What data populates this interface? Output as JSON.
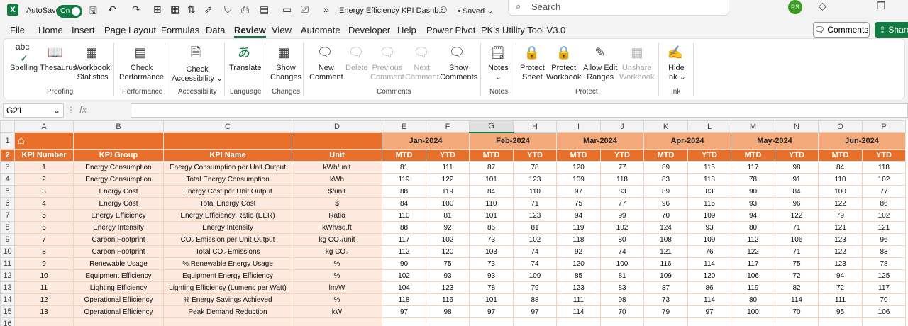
{
  "titlebar": {
    "app_icon": "X",
    "autosave_label": "AutoSave",
    "toggle_label": "On",
    "doc_title": "Energy Efficiency KPI Dashb...",
    "saved_label": "Saved",
    "search_placeholder": "Search",
    "avatar": "PS"
  },
  "menu": [
    "File",
    "Home",
    "Insert",
    "Page Layout",
    "Formulas",
    "Data",
    "Review",
    "View",
    "Automate",
    "Developer",
    "Help",
    "Power Pivot",
    "PK's Utility Tool V3.0"
  ],
  "active_menu": "Review",
  "comments_btn": "Comments",
  "share_btn": "Share",
  "ribbon": {
    "spelling_top": "abc",
    "spelling": "Spelling",
    "thesaurus": "Thesaurus",
    "wb_stats_1": "Workbook",
    "wb_stats_2": "Statistics",
    "check_perf_1": "Check",
    "check_perf_2": "Performance",
    "check_acc_1": "Check",
    "check_acc_2": "Accessibility",
    "translate": "Translate",
    "show_changes_1": "Show",
    "show_changes_2": "Changes",
    "new_comment_1": "New",
    "new_comment_2": "Comment",
    "delete": "Delete",
    "previous_1": "Previous",
    "previous_2": "Comment",
    "next_1": "Next",
    "next_2": "Comment",
    "show_comments_1": "Show",
    "show_comments_2": "Comments",
    "notes": "Notes",
    "protect_sheet_1": "Protect",
    "protect_sheet_2": "Sheet",
    "protect_wb_1": "Protect",
    "protect_wb_2": "Workbook",
    "allow_edit_1": "Allow Edit",
    "allow_edit_2": "Ranges",
    "unshare_1": "Unshare",
    "unshare_2": "Workbook",
    "hide_ink_1": "Hide",
    "hide_ink_2": "Ink",
    "groups": {
      "proofing": "Proofing",
      "performance": "Performance",
      "accessibility": "Accessibility",
      "language": "Language",
      "changes": "Changes",
      "comments": "Comments",
      "notes": "Notes",
      "protect": "Protect",
      "ink": "Ink"
    }
  },
  "formula_bar": {
    "name_box": "G21",
    "fx": "fx"
  },
  "columns": [
    "A",
    "B",
    "C",
    "D",
    "E",
    "F",
    "G",
    "H",
    "I",
    "J",
    "K",
    "L",
    "M",
    "N",
    "O",
    "P"
  ],
  "rows": [
    "1",
    "2",
    "3",
    "4",
    "5",
    "6",
    "7",
    "8",
    "9",
    "10",
    "11",
    "12",
    "13",
    "14",
    "15",
    "16"
  ],
  "header": {
    "kpi_number": "KPI Number",
    "kpi_group": "KPI Group",
    "kpi_name": "KPI Name",
    "unit": "Unit",
    "months": [
      "Jan-2024",
      "Feb-2024",
      "Mar-2024",
      "Apr-2024",
      "May-2024",
      "Jun-2024"
    ],
    "mtd": "MTD",
    "ytd": "YTD"
  },
  "table": [
    {
      "num": "1",
      "group": "Energy Consumption",
      "name": "Energy Consumption per Unit Output",
      "unit": "kWh/unit",
      "v": [
        "81",
        "111",
        "87",
        "78",
        "120",
        "77",
        "89",
        "116",
        "117",
        "98",
        "84",
        "118"
      ]
    },
    {
      "num": "2",
      "group": "Energy Consumption",
      "name": "Total Energy Consumption",
      "unit": "kWh",
      "v": [
        "119",
        "122",
        "101",
        "123",
        "109",
        "118",
        "83",
        "118",
        "78",
        "91",
        "110",
        "102"
      ]
    },
    {
      "num": "3",
      "group": "Energy Cost",
      "name": "Energy Cost per Unit Output",
      "unit": "$/unit",
      "v": [
        "88",
        "119",
        "84",
        "110",
        "97",
        "83",
        "89",
        "83",
        "90",
        "84",
        "100",
        "77"
      ]
    },
    {
      "num": "4",
      "group": "Energy Cost",
      "name": "Total Energy Cost",
      "unit": "$",
      "v": [
        "84",
        "100",
        "110",
        "71",
        "75",
        "77",
        "96",
        "115",
        "93",
        "96",
        "122",
        "86"
      ]
    },
    {
      "num": "5",
      "group": "Energy Efficiency",
      "name": "Energy Efficiency Ratio (EER)",
      "unit": "Ratio",
      "v": [
        "110",
        "81",
        "101",
        "123",
        "94",
        "99",
        "70",
        "109",
        "94",
        "122",
        "79",
        "102"
      ]
    },
    {
      "num": "6",
      "group": "Energy Intensity",
      "name": "Energy Intensity",
      "unit": "kWh/sq.ft",
      "v": [
        "88",
        "92",
        "86",
        "81",
        "119",
        "102",
        "124",
        "93",
        "80",
        "71",
        "121",
        "121"
      ]
    },
    {
      "num": "7",
      "group": "Carbon Footprint",
      "name": "CO₂ Emission per Unit Output",
      "unit": "kg CO₂/unit",
      "v": [
        "117",
        "102",
        "73",
        "102",
        "118",
        "80",
        "108",
        "109",
        "112",
        "106",
        "123",
        "96"
      ]
    },
    {
      "num": "8",
      "group": "Carbon Footprint",
      "name": "Total CO₂ Emissions",
      "unit": "kg CO₂",
      "v": [
        "112",
        "120",
        "103",
        "74",
        "92",
        "74",
        "121",
        "76",
        "122",
        "71",
        "122",
        "83"
      ]
    },
    {
      "num": "9",
      "group": "Renewable Usage",
      "name": "% Renewable Energy Usage",
      "unit": "%",
      "v": [
        "90",
        "75",
        "73",
        "74",
        "120",
        "100",
        "116",
        "114",
        "117",
        "75",
        "123",
        "78"
      ]
    },
    {
      "num": "10",
      "group": "Equipment Efficiency",
      "name": "Equipment Energy Efficiency",
      "unit": "%",
      "v": [
        "102",
        "93",
        "93",
        "109",
        "85",
        "81",
        "109",
        "120",
        "106",
        "72",
        "94",
        "125"
      ]
    },
    {
      "num": "11",
      "group": "Lighting Efficiency",
      "name": "Lighting Efficiency (Lumens per Watt)",
      "unit": "lm/W",
      "v": [
        "104",
        "123",
        "78",
        "79",
        "123",
        "83",
        "87",
        "86",
        "119",
        "82",
        "72",
        "117"
      ]
    },
    {
      "num": "12",
      "group": "Operational Efficiency",
      "name": "% Energy Savings Achieved",
      "unit": "%",
      "v": [
        "118",
        "116",
        "101",
        "88",
        "111",
        "98",
        "73",
        "114",
        "80",
        "114",
        "111",
        "70"
      ]
    },
    {
      "num": "13",
      "group": "Operational Efficiency",
      "name": "Peak Demand Reduction",
      "unit": "kW",
      "v": [
        "97",
        "98",
        "97",
        "97",
        "114",
        "70",
        "79",
        "97",
        "100",
        "70",
        "95",
        "106"
      ]
    }
  ]
}
